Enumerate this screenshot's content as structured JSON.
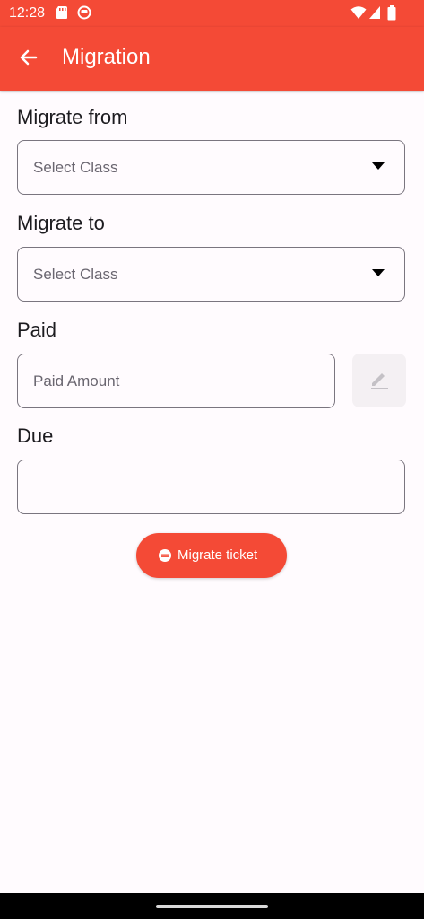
{
  "status_bar": {
    "time": "12:28"
  },
  "app_bar": {
    "title": "Migration"
  },
  "form": {
    "migrate_from": {
      "label": "Migrate from",
      "placeholder": "Select Class"
    },
    "migrate_to": {
      "label": "Migrate to",
      "placeholder": "Select Class"
    },
    "paid": {
      "label": "Paid",
      "placeholder": "Paid Amount"
    },
    "due": {
      "label": "Due",
      "value": ""
    }
  },
  "actions": {
    "migrate_label": "Migrate ticket"
  },
  "icons": {
    "back": "arrow-back-icon",
    "edit": "pencil-icon",
    "migrate": "minus-circle-icon",
    "dropdown": "triangle-down-icon"
  },
  "colors": {
    "primary": "#f44a36",
    "background": "#fffbfe",
    "outline": "#7a757f"
  }
}
